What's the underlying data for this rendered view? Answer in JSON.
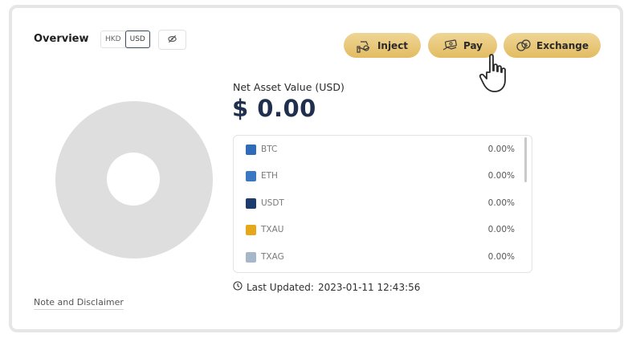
{
  "overview": {
    "title": "Overview",
    "currency_options": [
      "HKD",
      "USD"
    ],
    "selected_currency": "USD",
    "hide_icon": "eye-slash-icon"
  },
  "actions": {
    "inject": {
      "label": "Inject",
      "icon": "hand-coin-icon"
    },
    "pay": {
      "label": "Pay",
      "icon": "cash-hand-icon"
    },
    "exchange": {
      "label": "Exchange",
      "icon": "coin-exchange-icon"
    }
  },
  "nav": {
    "label": "Net Asset Value (USD)",
    "value": "$ 0.00"
  },
  "assets": [
    {
      "name": "BTC",
      "percent": "0.00%",
      "color": "#2f6bb8"
    },
    {
      "name": "ETH",
      "percent": "0.00%",
      "color": "#3b78c4"
    },
    {
      "name": "USDT",
      "percent": "0.00%",
      "color": "#1c3c6e"
    },
    {
      "name": "TXAU",
      "percent": "0.00%",
      "color": "#e5a81a"
    },
    {
      "name": "TXAG",
      "percent": "0.00%",
      "color": "#a6b7c9"
    }
  ],
  "last_updated": {
    "label": "Last Updated:",
    "value": "2023-01-11 12:43:56"
  },
  "footer": {
    "note_link": "Note and Disclaimer"
  },
  "colors": {
    "accent_gold": "#e2bc62",
    "nav_value": "#1f2f4d",
    "donut_empty": "#dedede"
  }
}
